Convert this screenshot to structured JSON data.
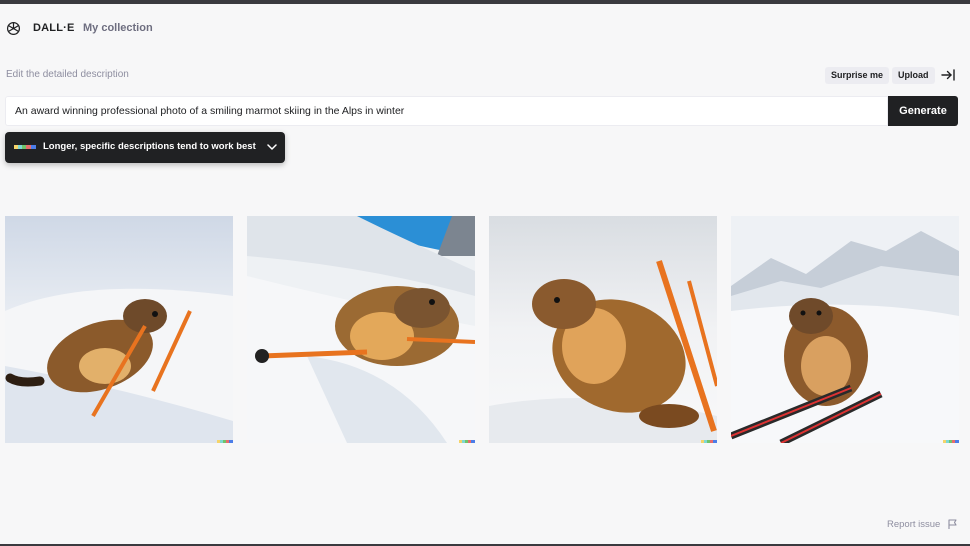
{
  "nav": {
    "brand": "DALL·E",
    "collection": "My collection"
  },
  "editor": {
    "label": "Edit the detailed description",
    "surprise_label": "Surprise me",
    "upload_label": "Upload",
    "prompt_value": "An award winning professional photo of a smiling marmot skiing in the Alps in winter",
    "generate_label": "Generate"
  },
  "tip": {
    "text": "Longer, specific descriptions tend to work best"
  },
  "footer": {
    "report_label": "Report issue"
  },
  "icons": {
    "logo": "openai-logo-icon",
    "collapse": "arrow-to-right-icon",
    "tip_chevron": "chevron-down-icon",
    "report": "flag-icon"
  },
  "colors": {
    "accent": "#202123",
    "background": "#f7f7f8",
    "muted": "#8e8ea0"
  }
}
